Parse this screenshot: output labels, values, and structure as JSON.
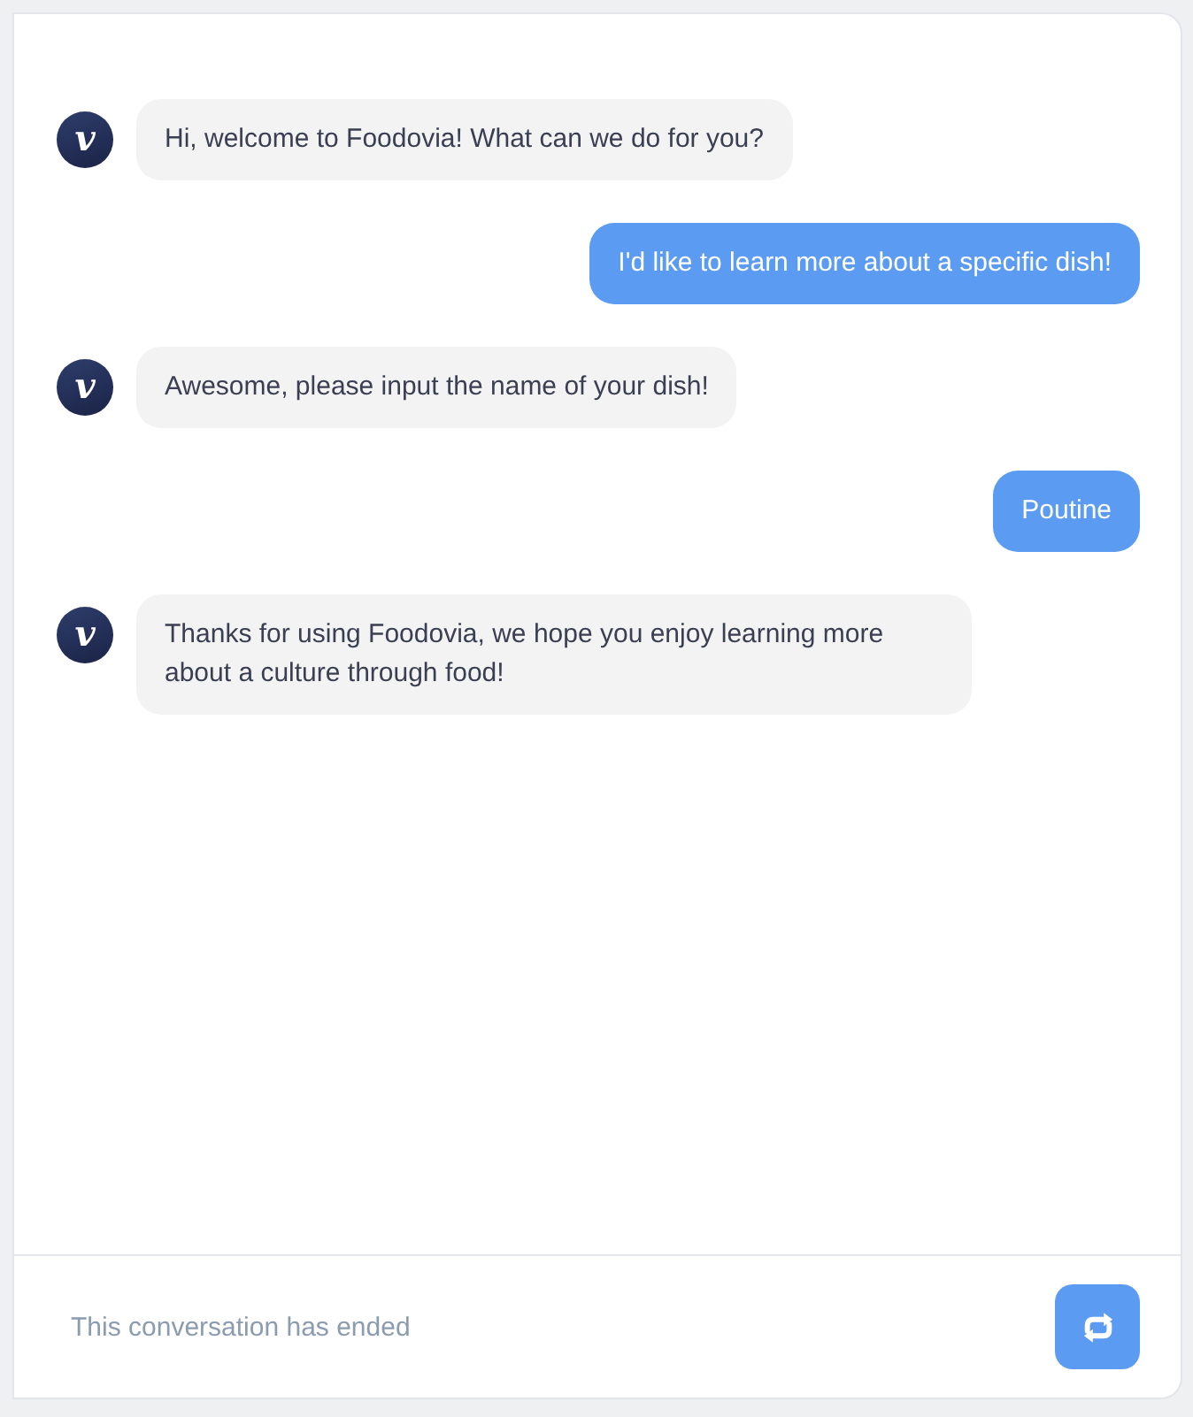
{
  "messages": [
    {
      "kind": "bot",
      "avatar": "v",
      "text": "Hi, welcome to Foodovia! What can we do for you?"
    },
    {
      "kind": "user",
      "text": "I'd like to learn more about a specific dish!"
    },
    {
      "kind": "bot",
      "avatar": "v",
      "text": "Awesome, please input the name of your dish!"
    },
    {
      "kind": "user",
      "text": "Poutine"
    },
    {
      "kind": "bot",
      "avatar": "v",
      "text": "Thanks for using Foodovia, we hope you enjoy learning more about a culture through food!"
    }
  ],
  "footer": {
    "status": "This conversation has ended"
  }
}
